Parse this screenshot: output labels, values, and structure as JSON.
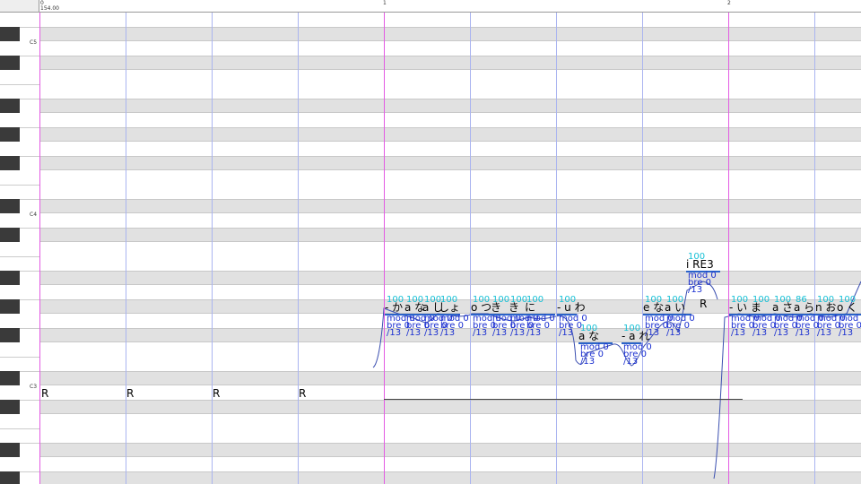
{
  "ruler": {
    "bar0": "0",
    "tempo": "154.00",
    "bar1": "1",
    "bar2": "2"
  },
  "keyboard": {
    "octaves": [
      "C5",
      "C4",
      "C3"
    ]
  },
  "colors": {
    "bar_line": "#e35be3",
    "beat_line": "#aab4f0",
    "velocity": "#16c0d6",
    "param": "#1a2fd0",
    "lyric": "#000000",
    "pitch_curve": "#3b4fb0"
  },
  "rests": [
    "R",
    "R",
    "R",
    "R",
    "R"
  ],
  "notes": [
    {
      "lyric": "- か",
      "vel": "100",
      "mod": "mod 0",
      "bre": "bre 0",
      "last": "/13"
    },
    {
      "lyric": "a な",
      "vel": "100",
      "mod": "mod 0",
      "bre": "bre 0",
      "last": "/13"
    },
    {
      "lyric": "a し",
      "vel": "100",
      "mod": "mod 0",
      "bre": "bre 0",
      "last": "/13"
    },
    {
      "lyric": "しょ",
      "vel": "100",
      "mod": "mod 0",
      "bre": "bre 0",
      "last": "/13"
    },
    {
      "lyric": "o つ",
      "vel": "100",
      "mod": "mod 0",
      "bre": "bre 0",
      "last": "/13"
    },
    {
      "lyric": "き",
      "vel": "100",
      "mod": "mod 0",
      "bre": "bre 0",
      "last": "/13"
    },
    {
      "lyric": "き",
      "vel": "100",
      "mod": "mod 0",
      "bre": "bre 0",
      "last": "/13"
    },
    {
      "lyric": "に",
      "vel": "100",
      "mod": "mod 0",
      "bre": "bre 0",
      "last": "/13"
    },
    {
      "lyric": "- u わ",
      "vel": "100",
      "mod": "mod 0",
      "bre": "bre 0",
      "last": "/13"
    },
    {
      "lyric": "a な",
      "vel": "100",
      "mod": "mod 0",
      "bre": "bre 0",
      "last": "/13"
    },
    {
      "lyric": "- a れ",
      "vel": "100",
      "mod": "mod 0",
      "bre": "bre 0",
      "last": "/13"
    },
    {
      "lyric": "e な",
      "vel": "100",
      "mod": "mod 0",
      "bre": "bre 0",
      "last": "/13"
    },
    {
      "lyric": "a い",
      "vel": "100",
      "mod": "mod 0",
      "bre": "bre 0",
      "last": "/13"
    },
    {
      "lyric": "i RE3",
      "vel": "100",
      "mod": "mod 0",
      "bre": "bre 0",
      "last": "/13"
    },
    {
      "lyric": "- い",
      "vel": "100",
      "mod": "mod 0",
      "bre": "bre 0",
      "last": "/13"
    },
    {
      "lyric": "ま",
      "vel": "100",
      "mod": "mod 0",
      "bre": "bre 0",
      "last": "/13"
    },
    {
      "lyric": "a さ",
      "vel": "100",
      "mod": "mod 0",
      "bre": "bre 0",
      "last": "/13"
    },
    {
      "lyric": "a ら",
      "vel": "86",
      "mod": "mod 0",
      "bre": "bre 0",
      "last": "/13"
    },
    {
      "lyric": "n お",
      "vel": "100",
      "mod": "mod 0",
      "bre": "bre 0",
      "last": "/13"
    },
    {
      "lyric": "o く",
      "vel": "100",
      "mod": "mod 0",
      "bre": "bre 0",
      "last": "/13"
    }
  ]
}
